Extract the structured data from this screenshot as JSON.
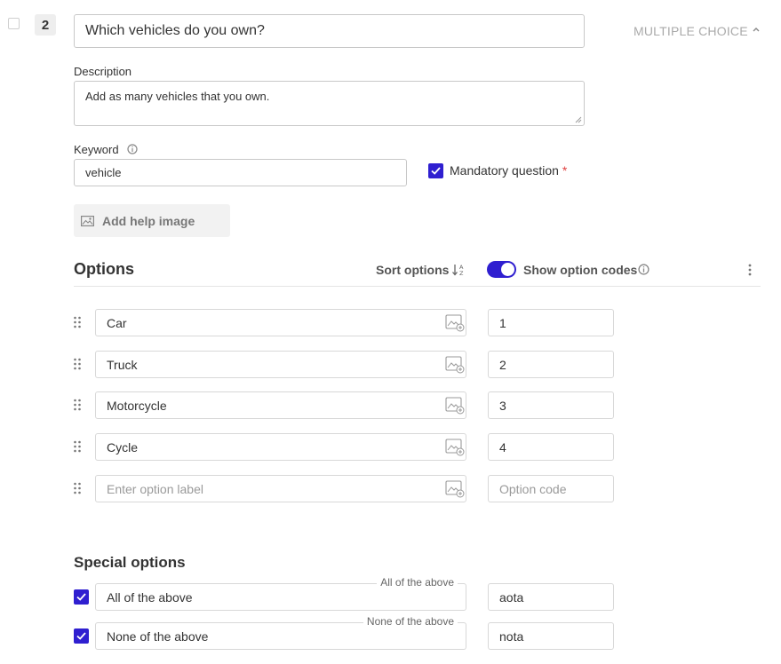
{
  "question": {
    "number": "2",
    "title": "Which vehicles do you own?",
    "type_label": "MULTIPLE CHOICE",
    "description_label": "Description",
    "description_value": "Add as many vehicles that you own.",
    "keyword_label": "Keyword",
    "keyword_value": "vehicle",
    "mandatory_label": "Mandatory question",
    "mandatory_star": "*",
    "mandatory_checked": true,
    "help_image_label": "Add help image"
  },
  "options_header": {
    "title": "Options",
    "sort_label": "Sort options",
    "show_codes_label": "Show option codes",
    "show_codes_on": true
  },
  "options": [
    {
      "label": "Car",
      "code": "1"
    },
    {
      "label": "Truck",
      "code": "2"
    },
    {
      "label": "Motorcycle",
      "code": "3"
    },
    {
      "label": "Cycle",
      "code": "4"
    }
  ],
  "new_option": {
    "label_placeholder": "Enter option label",
    "code_placeholder": "Option code"
  },
  "special": {
    "title": "Special options",
    "items": [
      {
        "legend": "All of the above",
        "label": "All of the above",
        "code": "aota",
        "checked": true
      },
      {
        "legend": "None of the above",
        "label": "None of the above",
        "code": "nota",
        "checked": true
      }
    ]
  },
  "icons": {
    "info": "info-icon",
    "sort": "sort-az-icon",
    "image": "image-icon",
    "drag": "drag-handle-icon",
    "more": "more-vertical-icon",
    "chevron": "chevron-up-icon"
  },
  "colors": {
    "accent": "#2f1fd0",
    "required": "#e04040",
    "muted": "#aaaaaa"
  }
}
